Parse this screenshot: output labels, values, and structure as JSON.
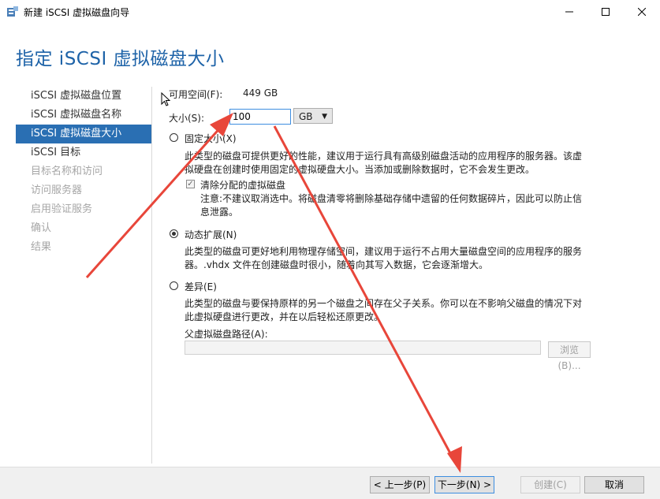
{
  "window": {
    "title": "新建 iSCSI 虚拟磁盘向导",
    "heading": "指定 iSCSI 虚拟磁盘大小",
    "controls": {
      "minimize": "—",
      "maximize": "☐",
      "close": "✕"
    }
  },
  "nav": {
    "items": [
      {
        "label": "iSCSI 虚拟磁盘位置"
      },
      {
        "label": "iSCSI 虚拟磁盘名称"
      },
      {
        "label": "iSCSI 虚拟磁盘大小"
      },
      {
        "label": "iSCSI 目标"
      },
      {
        "label": "目标名称和访问"
      },
      {
        "label": "访问服务器"
      },
      {
        "label": "启用验证服务"
      },
      {
        "label": "确认"
      },
      {
        "label": "结果"
      }
    ],
    "active_index": 2
  },
  "content": {
    "available_label": "可用空间(F):",
    "available_value": "449 GB",
    "size_label": "大小(S):",
    "size_value": "100",
    "unit": "GB",
    "fixed": {
      "label": "固定大小(X)",
      "desc_line1": "此类型的磁盘可提供更好的性能，建议用于运行具有高级别磁盘活动的应用程序的服务器。该虚",
      "desc_line2": "拟硬盘在创建时使用固定的虚拟硬盘大小。当添加或删除数据时，它不会发生更改。",
      "clear_label": "清除分配的虚拟磁盘",
      "clear_note_line1": "注意:不建议取消选中。将磁盘清零将删除基础存储中遗留的任何数据碎片，因此可以防止信",
      "clear_note_line2": "息泄露。"
    },
    "dynamic": {
      "label": "动态扩展(N)",
      "desc_line1": "此类型的磁盘可更好地利用物理存储空间，建议用于运行不占用大量磁盘空间的应用程序的服务",
      "desc_line2": "器。.vhdx 文件在创建磁盘时很小，随着向其写入数据，它会逐渐增大。"
    },
    "differencing": {
      "label": "差异(E)",
      "desc_line1": "此类型的磁盘与要保持原样的另一个磁盘之间存在父子关系。你可以在不影响父磁盘的情况下对",
      "desc_line2": "此虚拟硬盘进行更改，并在以后轻松还原更改。",
      "parent_label": "父虚拟磁盘路径(A):",
      "parent_value": "",
      "browse_label": "浏览(B)..."
    }
  },
  "footer": {
    "prev": "< 上一步(P)",
    "next": "下一步(N) >",
    "create": "创建(C)",
    "cancel": "取消"
  },
  "colors": {
    "heading": "#1e63a8",
    "nav_active": "#2a6fb3",
    "annotation_arrow": "#e8463a"
  },
  "icons": {
    "app": "server-wizard-icon",
    "pointer": "mouse-pointer-icon"
  }
}
